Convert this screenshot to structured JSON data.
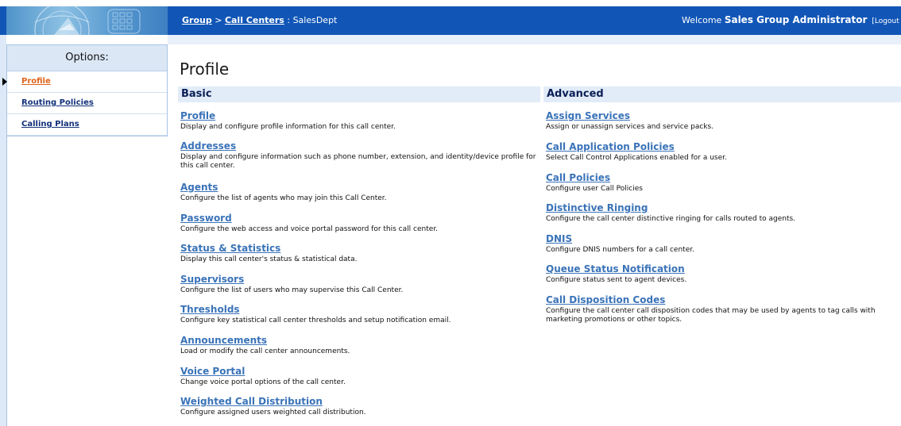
{
  "header": {
    "breadcrumb": {
      "group": "Group",
      "separator": " > ",
      "call_centers": "Call Centers",
      "colon": " : ",
      "current": "SalesDept"
    },
    "welcome_prefix": "Welcome ",
    "user": "Sales Group Administrator",
    "logout": "[Logout"
  },
  "sidebar": {
    "heading": "Options:",
    "items": [
      {
        "label": "Profile"
      },
      {
        "label": "Routing Policies"
      },
      {
        "label": "Calling Plans"
      }
    ]
  },
  "main": {
    "title": "Profile",
    "basic": {
      "heading": "Basic",
      "items": [
        {
          "title": "Profile",
          "desc": "Display and configure profile information for this call center."
        },
        {
          "title": "Addresses",
          "desc": "Display and configure information such as phone number, extension, and identity/device profile for this call center."
        },
        {
          "title": "Agents",
          "desc": "Configure the list of agents who may join this Call Center."
        },
        {
          "title": "Password",
          "desc": "Configure the web access and voice portal password for this call center."
        },
        {
          "title": "Status & Statistics",
          "desc": "Display this call center's status & statistical data."
        },
        {
          "title": "Supervisors",
          "desc": "Configure the list of users who may supervise this Call Center."
        },
        {
          "title": "Thresholds",
          "desc": "Configure key statistical call center thresholds and setup notification email."
        },
        {
          "title": "Announcements",
          "desc": "Load or modify the call center announcements."
        },
        {
          "title": "Voice Portal",
          "desc": "Change voice portal options of the call center."
        },
        {
          "title": "Weighted Call Distribution",
          "desc": "Configure assigned users weighted call distribution."
        }
      ]
    },
    "advanced": {
      "heading": "Advanced",
      "items": [
        {
          "title": "Assign Services",
          "desc": "Assign or unassign services and service packs."
        },
        {
          "title": "Call Application Policies",
          "desc": "Select Call Control Applications enabled for a user."
        },
        {
          "title": "Call Policies",
          "desc": "Configure user Call Policies"
        },
        {
          "title": "Distinctive Ringing",
          "desc": "Configure the call center distinctive ringing for calls routed to agents."
        },
        {
          "title": "DNIS",
          "desc": "Configure DNIS numbers for a call center."
        },
        {
          "title": "Queue Status Notification",
          "desc": "Configure status sent to agent devices."
        },
        {
          "title": "Call Disposition Codes",
          "desc": "Configure the call center call disposition codes that may be used by agents to tag calls with marketing promotions or other topics."
        }
      ]
    }
  },
  "colors": {
    "header_bg": "#1156b7",
    "link": "#3a73b8",
    "active_link": "#e0631a",
    "sidebar_link": "#12307a",
    "section_bg": "#e2ecf8"
  }
}
